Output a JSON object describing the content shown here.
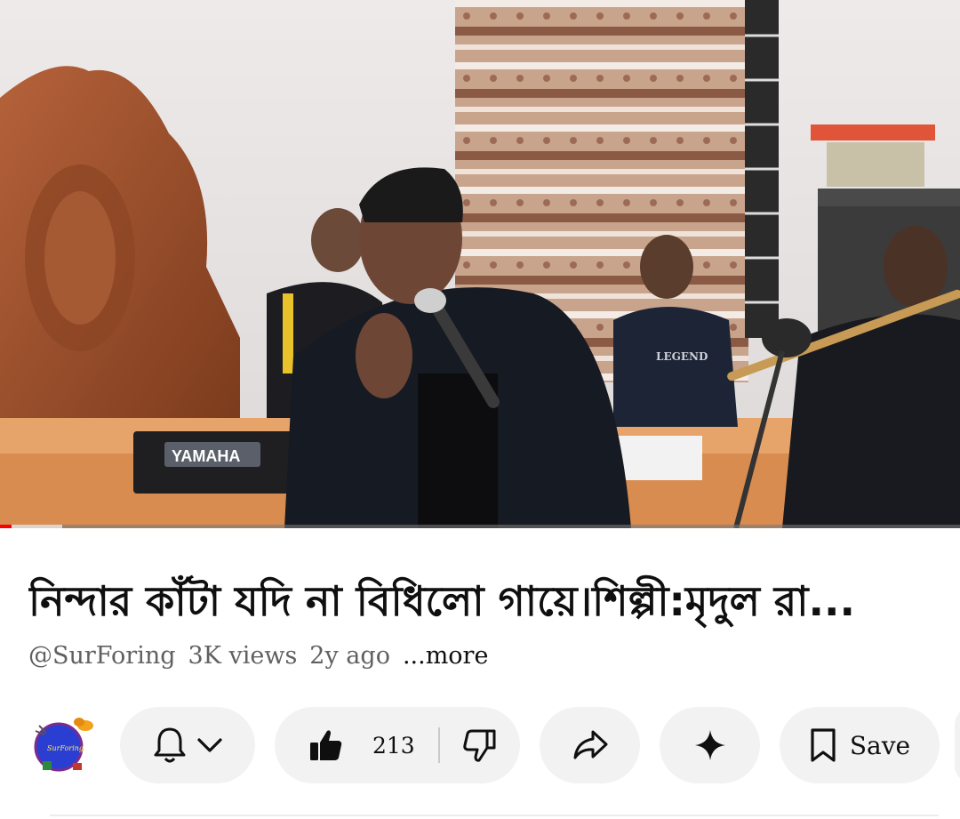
{
  "video": {
    "progress_fraction": 0.012,
    "buffered_fraction": 0.065,
    "keyboard_brand": "YAMAHA",
    "shirt_print": "LEGEND"
  },
  "title": "নিন্দার কাঁটা যদি না বিধিলো গায়ে।শিল্পী:মৃদুল রা...",
  "meta": {
    "channel_handle": "@SurForing",
    "views": "3K views",
    "age": "2y ago",
    "more_label": "...more"
  },
  "channel_avatar": {
    "logo_text": "SurForing"
  },
  "actions": {
    "like_count": "213",
    "save_label": "Save"
  },
  "icons": {
    "subscribe": "bell-icon",
    "dropdown": "chevron-down-icon",
    "like": "thumbs-up-icon",
    "dislike": "thumbs-down-icon",
    "share": "share-arrow-icon",
    "remix": "sparkle-icon",
    "save": "bookmark-icon"
  },
  "colors": {
    "progress": "#ff0000",
    "pill_bg": "#f2f2f2",
    "meta_text": "#606060"
  }
}
